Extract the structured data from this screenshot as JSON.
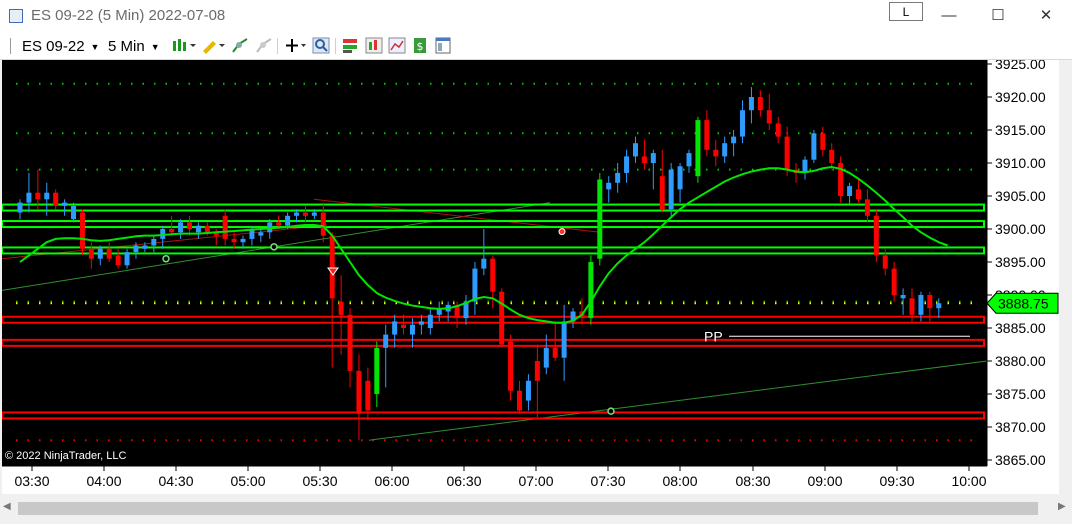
{
  "window": {
    "title": "ES 09-22 (5 Min)  2022-07-08",
    "link_button": "L",
    "minimize_glyph": "—",
    "maximize_glyph": "☐",
    "close_glyph": "✕"
  },
  "toolbar": {
    "instrument": "ES 09-22",
    "interval": "5 Min",
    "icons": [
      "bar-type-icon",
      "drawing-pencil-icon",
      "indicator-icon",
      "strategy-icon",
      "crosshair-icon",
      "zoom-icon",
      "chart-trader-icon",
      "bar-style-icon",
      "data-box-icon",
      "dollar-icon",
      "properties-icon"
    ]
  },
  "colors": {
    "background": "#000000",
    "up_candle": "#2e9cff",
    "down_candle": "#ff0000",
    "bull_breakout": "#00e600",
    "level_green": "#00ff00",
    "level_red": "#ff0000",
    "sma": "#00e600",
    "price_marker": "#00ff00"
  },
  "chart_data": {
    "type": "candlestick",
    "instrument": "ES 09-22",
    "interval": "5 Min",
    "date": "2022-07-08",
    "ylim": [
      3865,
      3925
    ],
    "yticks": [
      "3925.00",
      "3920.00",
      "3915.00",
      "3910.00",
      "3905.00",
      "3900.00",
      "3895.00",
      "3890.00",
      "3885.00",
      "3880.00",
      "3875.00",
      "3870.00",
      "3865.00"
    ],
    "xticks": [
      "03:30",
      "04:00",
      "04:30",
      "05:00",
      "05:30",
      "06:00",
      "06:30",
      "07:00",
      "07:30",
      "08:00",
      "08:30",
      "09:00",
      "09:30",
      "10:00"
    ],
    "last_price": "3888.75",
    "candles": [
      {
        "o": 3902.5,
        "h": 3904.5,
        "l": 3901.5,
        "c": 3904,
        "up": true
      },
      {
        "o": 3904,
        "h": 3908.5,
        "l": 3902.5,
        "c": 3905.5,
        "up": true
      },
      {
        "o": 3905.5,
        "h": 3909,
        "l": 3903,
        "c": 3904.5,
        "up": false
      },
      {
        "o": 3904.5,
        "h": 3907,
        "l": 3902,
        "c": 3905.5,
        "up": true
      },
      {
        "o": 3905.5,
        "h": 3906,
        "l": 3903,
        "c": 3903.5,
        "up": false
      },
      {
        "o": 3903.5,
        "h": 3904.5,
        "l": 3902,
        "c": 3904,
        "up": true
      },
      {
        "o": 3903.5,
        "h": 3904,
        "l": 3901,
        "c": 3901.5,
        "up": true
      },
      {
        "o": 3902.5,
        "h": 3903,
        "l": 3896,
        "c": 3897,
        "up": false
      },
      {
        "o": 3897,
        "h": 3898,
        "l": 3894,
        "c": 3895.5,
        "up": false
      },
      {
        "o": 3895.5,
        "h": 3897.5,
        "l": 3894.5,
        "c": 3897,
        "up": true
      },
      {
        "o": 3897,
        "h": 3898,
        "l": 3895,
        "c": 3895.5,
        "up": false
      },
      {
        "o": 3896,
        "h": 3897,
        "l": 3894,
        "c": 3894.5,
        "up": false
      },
      {
        "o": 3894.5,
        "h": 3897,
        "l": 3894,
        "c": 3896.5,
        "up": true
      },
      {
        "o": 3896.5,
        "h": 3898,
        "l": 3895.5,
        "c": 3897.5,
        "up": true
      },
      {
        "o": 3897,
        "h": 3898,
        "l": 3896.5,
        "c": 3897.5,
        "up": true
      },
      {
        "o": 3897.5,
        "h": 3899,
        "l": 3896.5,
        "c": 3898.5,
        "up": true
      },
      {
        "o": 3898.5,
        "h": 3900.5,
        "l": 3897,
        "c": 3900,
        "up": true
      },
      {
        "o": 3900,
        "h": 3902,
        "l": 3899,
        "c": 3899.5,
        "up": false
      },
      {
        "o": 3899.5,
        "h": 3901.5,
        "l": 3898.5,
        "c": 3901,
        "up": true
      },
      {
        "o": 3901,
        "h": 3902,
        "l": 3899,
        "c": 3900,
        "up": false
      },
      {
        "o": 3899.5,
        "h": 3901,
        "l": 3898.5,
        "c": 3900.5,
        "up": true
      },
      {
        "o": 3900.5,
        "h": 3901,
        "l": 3899,
        "c": 3899.5,
        "up": false
      },
      {
        "o": 3899.5,
        "h": 3900,
        "l": 3897.5,
        "c": 3899,
        "up": false
      },
      {
        "o": 3902,
        "h": 3903,
        "l": 3897.5,
        "c": 3898.5,
        "up": false
      },
      {
        "o": 3898.5,
        "h": 3899.5,
        "l": 3897,
        "c": 3898,
        "up": false
      },
      {
        "o": 3898,
        "h": 3899,
        "l": 3897,
        "c": 3898.5,
        "up": true
      },
      {
        "o": 3898.5,
        "h": 3900.5,
        "l": 3897.5,
        "c": 3900,
        "up": true
      },
      {
        "o": 3899,
        "h": 3900,
        "l": 3898,
        "c": 3899.5,
        "up": true
      },
      {
        "o": 3899.5,
        "h": 3901.5,
        "l": 3898.5,
        "c": 3901,
        "up": true
      },
      {
        "o": 3901,
        "h": 3902,
        "l": 3900,
        "c": 3900.5,
        "up": false
      },
      {
        "o": 3900.5,
        "h": 3902.5,
        "l": 3900,
        "c": 3902,
        "up": true
      },
      {
        "o": 3902,
        "h": 3903,
        "l": 3901,
        "c": 3902.5,
        "up": true
      },
      {
        "o": 3902.5,
        "h": 3903.5,
        "l": 3901,
        "c": 3902,
        "up": false
      },
      {
        "o": 3902,
        "h": 3903,
        "l": 3901.5,
        "c": 3902.5,
        "up": true
      },
      {
        "o": 3902.5,
        "h": 3904,
        "l": 3898,
        "c": 3899,
        "up": false
      },
      {
        "o": 3899,
        "h": 3899.5,
        "l": 3879,
        "c": 3889.5,
        "up": false
      },
      {
        "o": 3889,
        "h": 3893,
        "l": 3881,
        "c": 3887,
        "up": false
      },
      {
        "o": 3887,
        "h": 3888,
        "l": 3876,
        "c": 3878.5,
        "up": false
      },
      {
        "o": 3878.5,
        "h": 3881,
        "l": 3868,
        "c": 3872,
        "up": false
      },
      {
        "o": 3877,
        "h": 3879,
        "l": 3871,
        "c": 3872.5,
        "up": false
      },
      {
        "o": 3875,
        "h": 3883,
        "l": 3873,
        "c": 3882,
        "up": true
      },
      {
        "o": 3882,
        "h": 3885.5,
        "l": 3876,
        "c": 3884,
        "up": true
      },
      {
        "o": 3884,
        "h": 3887,
        "l": 3882,
        "c": 3886,
        "up": true
      },
      {
        "o": 3885.5,
        "h": 3887,
        "l": 3884,
        "c": 3885,
        "up": false
      },
      {
        "o": 3884,
        "h": 3886.5,
        "l": 3882,
        "c": 3885.5,
        "up": true
      },
      {
        "o": 3885.5,
        "h": 3887,
        "l": 3884,
        "c": 3886,
        "up": true
      },
      {
        "o": 3885,
        "h": 3888,
        "l": 3884,
        "c": 3887,
        "up": true
      },
      {
        "o": 3887,
        "h": 3889,
        "l": 3886,
        "c": 3888,
        "up": true
      },
      {
        "o": 3887.5,
        "h": 3889,
        "l": 3886,
        "c": 3888.5,
        "up": true
      },
      {
        "o": 3888.5,
        "h": 3889,
        "l": 3885,
        "c": 3886.5,
        "up": false
      },
      {
        "o": 3886.5,
        "h": 3890,
        "l": 3885.5,
        "c": 3889,
        "up": true
      },
      {
        "o": 3889,
        "h": 3895,
        "l": 3887,
        "c": 3894,
        "up": true
      },
      {
        "o": 3894,
        "h": 3900,
        "l": 3893,
        "c": 3895.5,
        "up": true
      },
      {
        "o": 3895.5,
        "h": 3896,
        "l": 3888,
        "c": 3890.5,
        "up": false
      },
      {
        "o": 3890.5,
        "h": 3891,
        "l": 3882,
        "c": 3882.5,
        "up": false
      },
      {
        "o": 3883,
        "h": 3884,
        "l": 3874,
        "c": 3875.5,
        "up": false
      },
      {
        "o": 3875.5,
        "h": 3877,
        "l": 3872,
        "c": 3872.5,
        "up": false
      },
      {
        "o": 3874,
        "h": 3878,
        "l": 3872.5,
        "c": 3877,
        "up": true
      },
      {
        "o": 3880,
        "h": 3882.5,
        "l": 3871.5,
        "c": 3877,
        "up": false
      },
      {
        "o": 3879,
        "h": 3884,
        "l": 3878,
        "c": 3882,
        "up": true
      },
      {
        "o": 3882,
        "h": 3886,
        "l": 3880,
        "c": 3880.5,
        "up": false
      },
      {
        "o": 3880.5,
        "h": 3888.5,
        "l": 3877,
        "c": 3886,
        "up": true
      },
      {
        "o": 3886,
        "h": 3888,
        "l": 3885,
        "c": 3887.5,
        "up": true
      },
      {
        "o": 3887.5,
        "h": 3889.5,
        "l": 3885.5,
        "c": 3886.5,
        "up": false
      },
      {
        "o": 3886.5,
        "h": 3896,
        "l": 3885.5,
        "c": 3895,
        "up": true
      },
      {
        "o": 3895.5,
        "h": 3908.5,
        "l": 3894.5,
        "c": 3907.5,
        "up": true
      },
      {
        "o": 3906,
        "h": 3908,
        "l": 3904,
        "c": 3907,
        "up": true
      },
      {
        "o": 3907,
        "h": 3910,
        "l": 3905.5,
        "c": 3908.5,
        "up": true
      },
      {
        "o": 3908.5,
        "h": 3912,
        "l": 3907,
        "c": 3911,
        "up": true
      },
      {
        "o": 3911,
        "h": 3914,
        "l": 3910,
        "c": 3913,
        "up": true
      },
      {
        "o": 3911,
        "h": 3913.5,
        "l": 3909,
        "c": 3910,
        "up": false
      },
      {
        "o": 3910,
        "h": 3912,
        "l": 3906,
        "c": 3911.5,
        "up": true
      },
      {
        "o": 3908,
        "h": 3912,
        "l": 3902.5,
        "c": 3903,
        "up": false
      },
      {
        "o": 3903,
        "h": 3910,
        "l": 3902,
        "c": 3909,
        "up": true
      },
      {
        "o": 3906,
        "h": 3910,
        "l": 3904,
        "c": 3909.5,
        "up": true
      },
      {
        "o": 3909.5,
        "h": 3912,
        "l": 3908.5,
        "c": 3911.5,
        "up": true
      },
      {
        "o": 3908,
        "h": 3917,
        "l": 3907,
        "c": 3916.5,
        "up": true
      },
      {
        "o": 3916.5,
        "h": 3918,
        "l": 3911,
        "c": 3912,
        "up": false
      },
      {
        "o": 3912,
        "h": 3913.5,
        "l": 3909.5,
        "c": 3911,
        "up": false
      },
      {
        "o": 3911,
        "h": 3914,
        "l": 3910,
        "c": 3913,
        "up": true
      },
      {
        "o": 3913,
        "h": 3915,
        "l": 3911,
        "c": 3914,
        "up": true
      },
      {
        "o": 3914,
        "h": 3919.5,
        "l": 3913,
        "c": 3918,
        "up": true
      },
      {
        "o": 3918,
        "h": 3921.5,
        "l": 3916,
        "c": 3920,
        "up": true
      },
      {
        "o": 3920,
        "h": 3921,
        "l": 3917,
        "c": 3918,
        "up": false
      },
      {
        "o": 3918,
        "h": 3920.5,
        "l": 3915,
        "c": 3916,
        "up": false
      },
      {
        "o": 3916,
        "h": 3917,
        "l": 3913,
        "c": 3914,
        "up": false
      },
      {
        "o": 3914,
        "h": 3915.5,
        "l": 3908,
        "c": 3909,
        "up": false
      },
      {
        "o": 3909,
        "h": 3910,
        "l": 3907,
        "c": 3908.5,
        "up": false
      },
      {
        "o": 3908.5,
        "h": 3911,
        "l": 3907.5,
        "c": 3910.5,
        "up": true
      },
      {
        "o": 3910.5,
        "h": 3915,
        "l": 3910,
        "c": 3914.5,
        "up": true
      },
      {
        "o": 3914.5,
        "h": 3915.5,
        "l": 3911,
        "c": 3912,
        "up": false
      },
      {
        "o": 3912,
        "h": 3913,
        "l": 3909,
        "c": 3910,
        "up": false
      },
      {
        "o": 3910,
        "h": 3911,
        "l": 3904,
        "c": 3905,
        "up": false
      },
      {
        "o": 3905,
        "h": 3907,
        "l": 3903.5,
        "c": 3906.5,
        "up": true
      },
      {
        "o": 3906,
        "h": 3907.5,
        "l": 3904,
        "c": 3904.5,
        "up": false
      },
      {
        "o": 3904.5,
        "h": 3906,
        "l": 3901,
        "c": 3902,
        "up": false
      },
      {
        "o": 3902,
        "h": 3903,
        "l": 3895,
        "c": 3896,
        "up": false
      },
      {
        "o": 3896,
        "h": 3897,
        "l": 3893,
        "c": 3894,
        "up": false
      },
      {
        "o": 3894,
        "h": 3895,
        "l": 3889,
        "c": 3890,
        "up": false
      },
      {
        "o": 3890,
        "h": 3891,
        "l": 3887,
        "c": 3889.5,
        "up": true
      },
      {
        "o": 3889.5,
        "h": 3891,
        "l": 3886,
        "c": 3887,
        "up": false
      },
      {
        "o": 3887,
        "h": 3890.5,
        "l": 3886,
        "c": 3890,
        "up": true
      },
      {
        "o": 3890,
        "h": 3890.5,
        "l": 3886,
        "c": 3888,
        "up": false
      },
      {
        "o": 3888,
        "h": 3889.5,
        "l": 3886.5,
        "c": 3888.75,
        "up": true
      }
    ],
    "green_levels": [
      3903.25,
      3900.75,
      3896.75
    ],
    "red_levels": [
      3886.25,
      3882.75,
      3871.75
    ],
    "dotted_levels": [
      {
        "y": 3922,
        "color": "#00c800"
      },
      {
        "y": 3914.5,
        "color": "#00c800"
      },
      {
        "y": 3909,
        "color": "#00c800"
      },
      {
        "y": 3889,
        "color": "#00c800"
      },
      {
        "y": 3888.75,
        "color": "#ffff00"
      },
      {
        "y": 3868,
        "color": "#ff0000"
      }
    ],
    "sma": [
      3895,
      3896,
      3897,
      3898,
      3898.5,
      3898.6,
      3898.6,
      3898.5,
      3898.3,
      3898.2,
      3898.3,
      3898.5,
      3898.7,
      3898.9,
      3899,
      3899,
      3899.1,
      3899.2,
      3899.3,
      3899.3,
      3899.3,
      3899.4,
      3899.5,
      3899.6,
      3899.7,
      3899.8,
      3899.9,
      3900,
      3900.1,
      3900.2,
      3900.3,
      3900.5,
      3900.6,
      3900.6,
      3900.4,
      3899,
      3897,
      3895,
      3893,
      3891.5,
      3890.3,
      3889.6,
      3889.1,
      3888.7,
      3888.4,
      3888.2,
      3888,
      3887.9,
      3888,
      3888.3,
      3888.8,
      3889.4,
      3889.7,
      3889.5,
      3888.7,
      3887.8,
      3887,
      3886.5,
      3886.2,
      3886,
      3885.8,
      3885.8,
      3886.1,
      3887,
      3889,
      3891.3,
      3893.3,
      3894.8,
      3896,
      3897,
      3898,
      3899.2,
      3900.5,
      3901.8,
      3903,
      3904,
      3904.8,
      3905.6,
      3906.4,
      3907.2,
      3907.8,
      3908.3,
      3908.7,
      3909,
      3909.2,
      3909.2,
      3909,
      3908.7,
      3908.6,
      3908.8,
      3909.2,
      3909.4,
      3909.1,
      3908.5,
      3907.6,
      3906.6,
      3905.5,
      3904.3,
      3903,
      3901.8,
      3900.5,
      3899.5,
      3898.7,
      3898,
      3897.5
    ],
    "pp_label": "PP",
    "pp_level": 3883.75,
    "copyright": "© 2022 NinjaTrader, LLC"
  }
}
